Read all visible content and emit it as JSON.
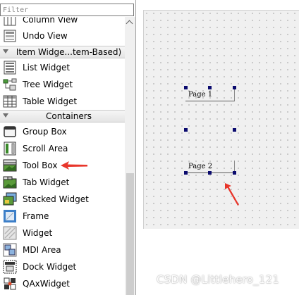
{
  "widget_box": {
    "filter_placeholder": "Filter",
    "sections": [
      {
        "type": "item",
        "label": "Column View",
        "icon": "column-view-icon"
      },
      {
        "type": "item",
        "label": "Undo View",
        "icon": "undo-view-icon"
      },
      {
        "type": "category",
        "label": "Item Widge...tem-Based)"
      },
      {
        "type": "item",
        "label": "List Widget",
        "icon": "list-widget-icon"
      },
      {
        "type": "item",
        "label": "Tree Widget",
        "icon": "tree-widget-icon"
      },
      {
        "type": "item",
        "label": "Table Widget",
        "icon": "table-widget-icon"
      },
      {
        "type": "category",
        "label": "Containers"
      },
      {
        "type": "item",
        "label": "Group Box",
        "icon": "group-box-icon"
      },
      {
        "type": "item",
        "label": "Scroll Area",
        "icon": "scroll-area-icon"
      },
      {
        "type": "item",
        "label": "Tool Box",
        "icon": "tool-box-icon"
      },
      {
        "type": "item",
        "label": "Tab Widget",
        "icon": "tab-widget-icon"
      },
      {
        "type": "item",
        "label": "Stacked Widget",
        "icon": "stacked-widget-icon"
      },
      {
        "type": "item",
        "label": "Frame",
        "icon": "frame-icon"
      },
      {
        "type": "item",
        "label": "Widget",
        "icon": "widget-icon"
      },
      {
        "type": "item",
        "label": "MDI Area",
        "icon": "mdi-area-icon"
      },
      {
        "type": "item",
        "label": "Dock Widget",
        "icon": "dock-widget-icon"
      },
      {
        "type": "item",
        "label": "QAxWidget",
        "icon": "qaxwidget-icon"
      }
    ]
  },
  "designer": {
    "pages": [
      {
        "label": "Page 1"
      },
      {
        "label": "Page 2"
      }
    ]
  },
  "watermark": "CSDN @Littlehero_121",
  "colors": {
    "annotation_arrow": "#e8362b",
    "selection_handle": "#0a0a6e",
    "form_background": "#f0f0f0"
  }
}
